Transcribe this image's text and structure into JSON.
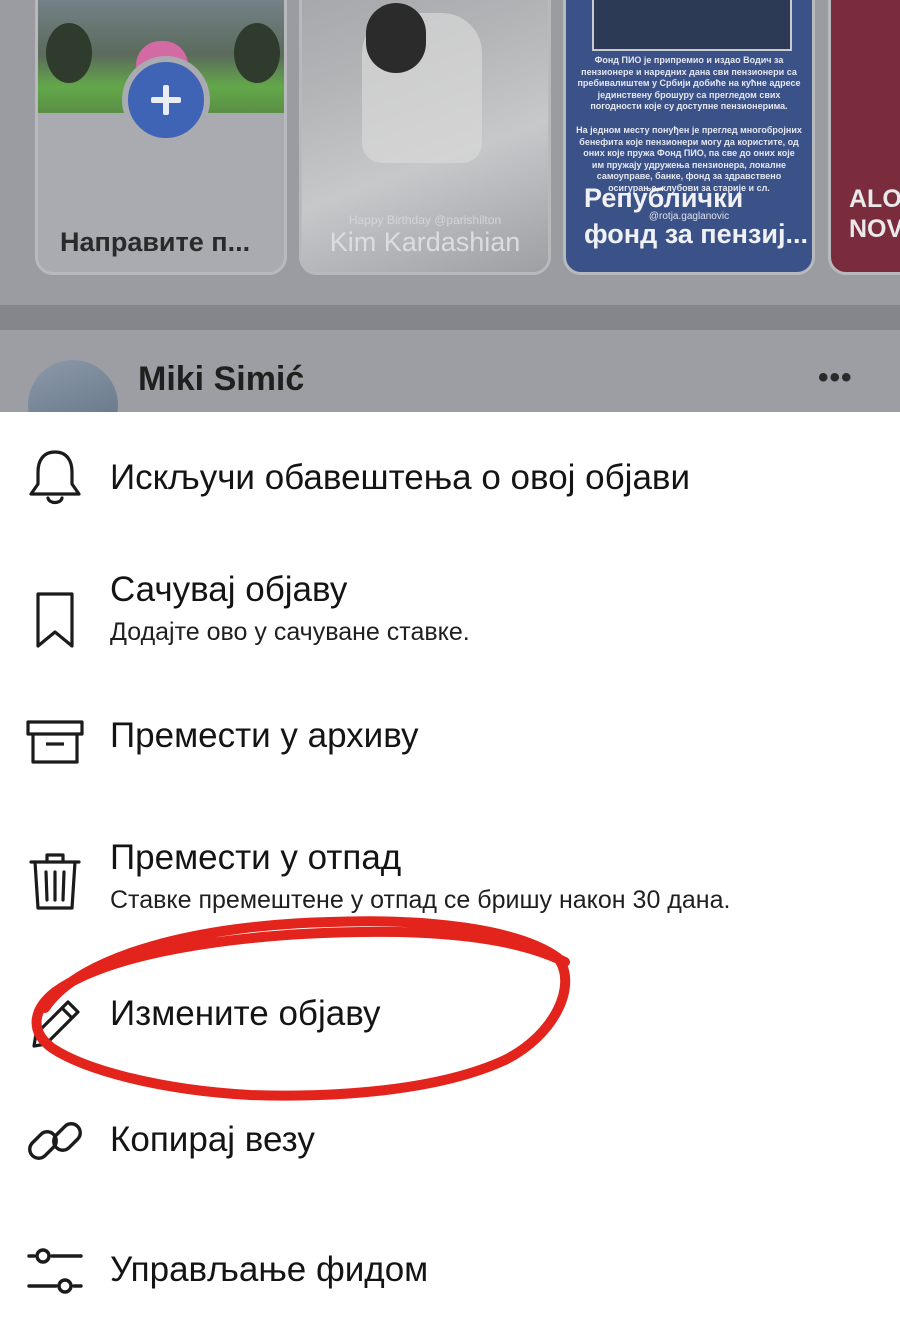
{
  "stories": {
    "create": {
      "label": "Направите п..."
    },
    "kim": {
      "label": "Kim Kardashian",
      "caption": "Happy Birthday @parishilton"
    },
    "pio": {
      "label_line1": "Републички",
      "label_line2": "фонд за пензиј...",
      "doc_text": "Фонд ПИО је припремио и издао Водич за пензионере и наредних дана сви пензионери са пребивалиштем у Србији добиће на кућне адресе јединствену брошуру са прегледом свих погодности које су доступне пензионерима.",
      "doc_text2": "На једном месту понуђен је преглед многобројних бенефита које пензионери могу да користите, од оних које пружа Фонд ПИО, па све до оних које им пружају удружења пензионера, локалне самоуправе, банке, фонд за здравствено осигурање, клубови за старије и сл.",
      "handle": "@rotja.gaglanovic"
    },
    "alo": {
      "label_line1": "ALO",
      "label_line2": "NOV"
    }
  },
  "post": {
    "author": "Miki Simić",
    "more": "•••"
  },
  "menu": [
    {
      "id": "notifications",
      "title": "Искључи обавештења о овој објави",
      "icon": "bell-icon"
    },
    {
      "id": "save",
      "title": "Сачувај објаву",
      "subtitle": "Додајте ово у сачуване ставке.",
      "icon": "bookmark-icon"
    },
    {
      "id": "archive",
      "title": "Премести у архиву",
      "icon": "archive-box-icon"
    },
    {
      "id": "trash",
      "title": "Премести у отпад",
      "subtitle": "Ставке премештене у отпад се бришу након 30 дана.",
      "icon": "trash-icon"
    },
    {
      "id": "edit",
      "title": "Измените објаву",
      "icon": "pencil-icon"
    },
    {
      "id": "copy-link",
      "title": "Копирај везу",
      "icon": "link-icon"
    },
    {
      "id": "feed",
      "title": "Управљање фидом",
      "icon": "sliders-icon"
    }
  ],
  "colors": {
    "overlay_gray": "#8f9196",
    "sheet_bg": "#ffffff",
    "annotation_red": "#e3241d",
    "create_plus_blue": "#3f63b5"
  }
}
